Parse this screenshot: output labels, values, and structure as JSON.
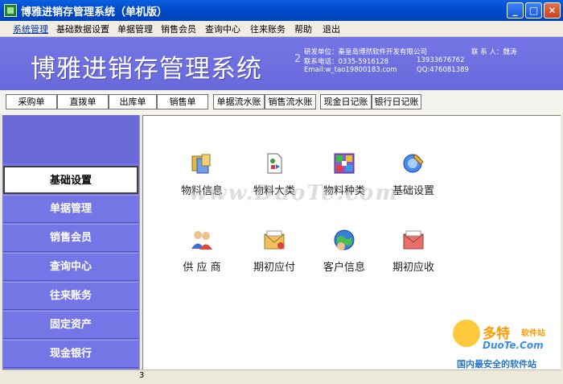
{
  "window": {
    "title": "博雅进销存管理系统（单机版）"
  },
  "menu": [
    "系统管理",
    "基础数据设置",
    "单据管理",
    "销售会员",
    "查询中心",
    "往来账务",
    "帮助",
    "退出"
  ],
  "banner": {
    "title": "博雅进销存管理系统",
    "version_fragment": "2",
    "dev_unit": "研发单位：秦皇岛博然软件开发有限公司",
    "contact_label": "联 系 人：魏涛",
    "phone": "联系电话：0335-5916128",
    "mobile": "13933676762",
    "email": "Email:w_tao19800183.com",
    "qq": "QQ:476081389"
  },
  "toolbar": [
    "采购单",
    "直拨单",
    "出库单",
    "销售单",
    "单据流水账",
    "销售流水账",
    "现金日记账",
    "银行日记账"
  ],
  "sidebar": {
    "items": [
      {
        "label": "基础设置",
        "active": true
      },
      {
        "label": "单据管理"
      },
      {
        "label": "销售会员"
      },
      {
        "label": "查询中心"
      },
      {
        "label": "往来账务"
      },
      {
        "label": "固定资产"
      },
      {
        "label": "现金银行"
      }
    ]
  },
  "main": {
    "icons": [
      {
        "label": "物料信息",
        "icon": "material-info-icon"
      },
      {
        "label": "物料大类",
        "icon": "material-category-icon"
      },
      {
        "label": "物料种类",
        "icon": "material-type-icon"
      },
      {
        "label": "基础设置",
        "icon": "basic-settings-icon"
      },
      {
        "label": "供 应 商",
        "icon": "supplier-icon"
      },
      {
        "label": "期初应付",
        "icon": "initial-payable-icon"
      },
      {
        "label": "客户信息",
        "icon": "customer-info-icon"
      },
      {
        "label": "期初应收",
        "icon": "initial-receivable-icon"
      }
    ]
  },
  "status": {
    "text": "3"
  },
  "watermark": {
    "text": "www.DuoTe.com",
    "logo": "多特",
    "logo_sub": "软件站",
    "logo_url": "DuoTe.Com",
    "slogan": "国内最安全的软件站"
  },
  "colors": {
    "banner": "#7576E6",
    "titlebar": "#0A5FE0",
    "menu_active": "#0033aa"
  }
}
